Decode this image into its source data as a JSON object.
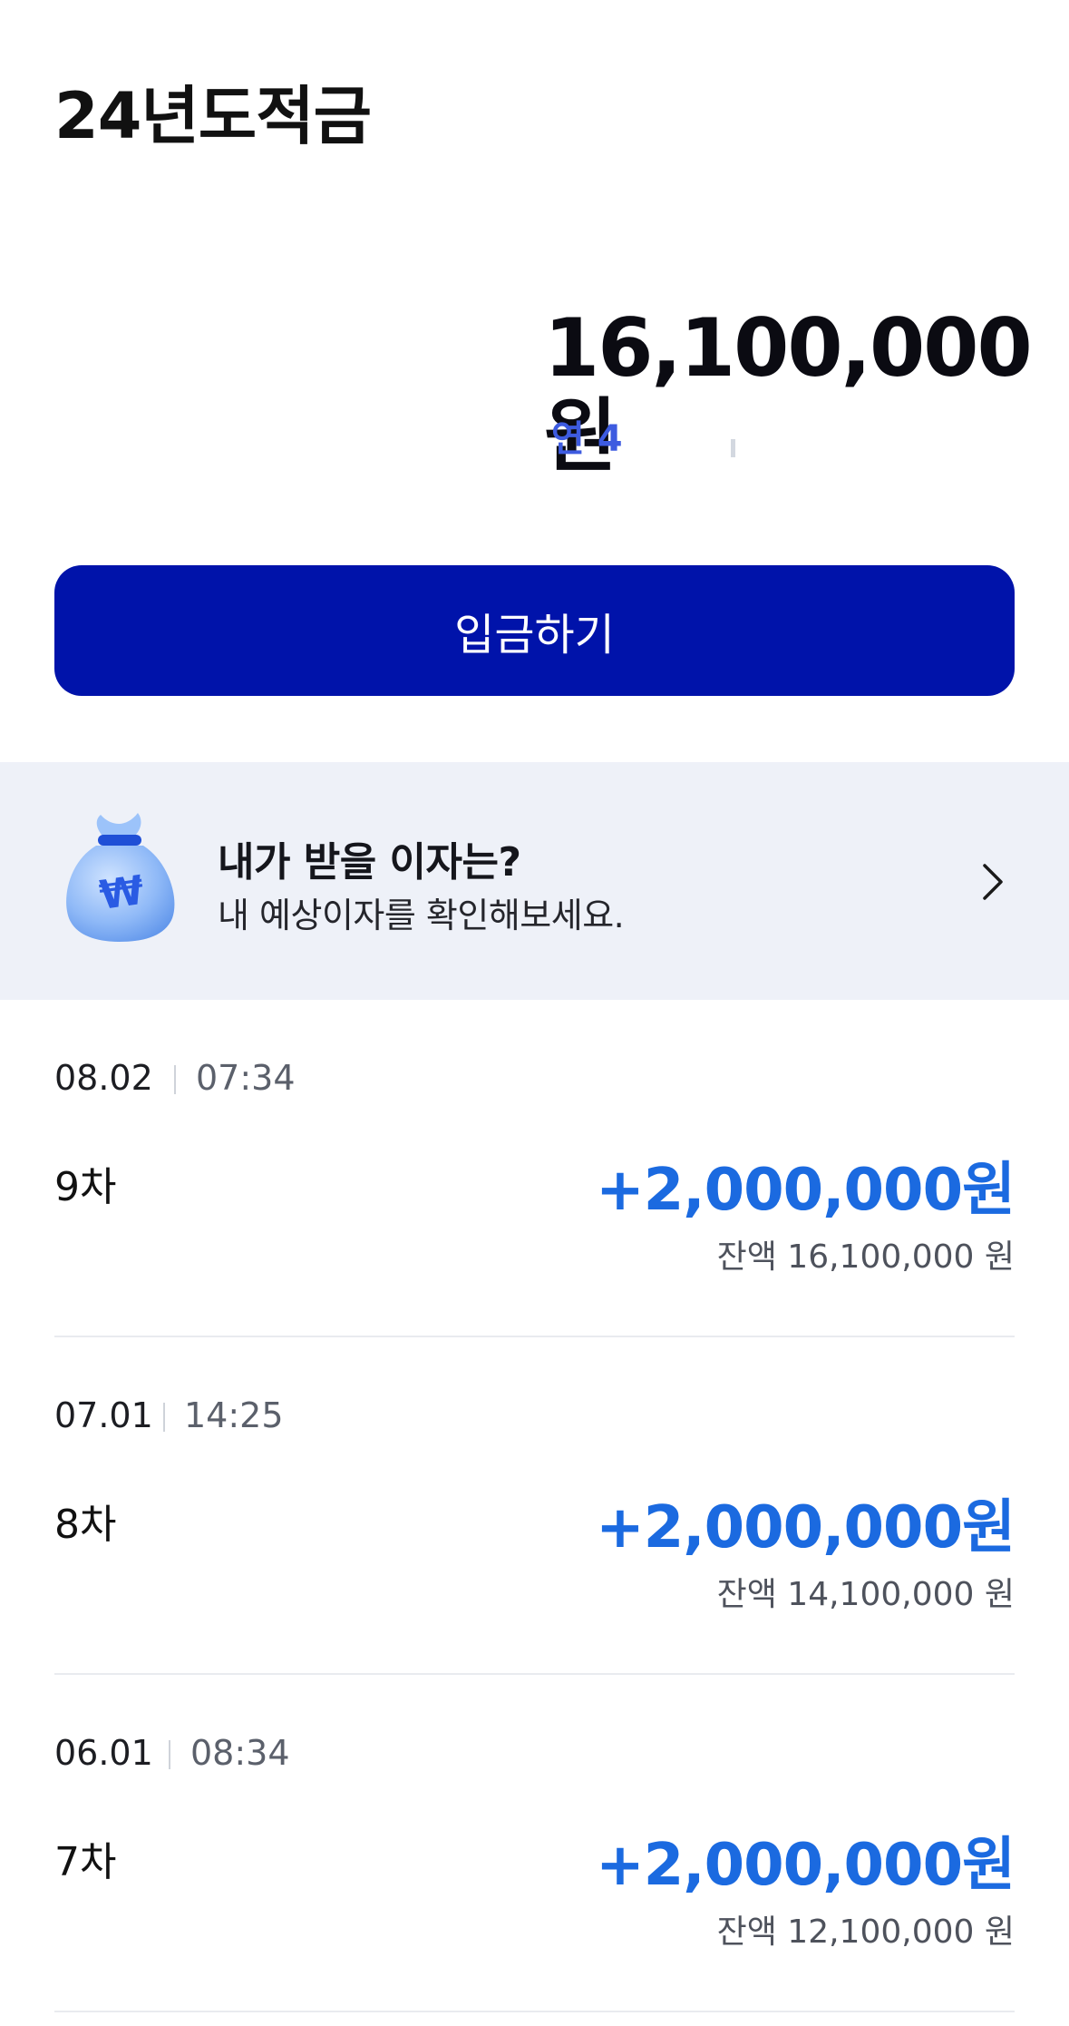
{
  "header": {
    "title": "24년도적금"
  },
  "summary": {
    "balance": "16,100,000원",
    "rate_visible": "연 4"
  },
  "actions": {
    "deposit_label": "입금하기"
  },
  "interest_banner": {
    "title": "내가 받을 이자는?",
    "subtitle": "내 예상이자를 확인해보세요."
  },
  "transactions": [
    {
      "date": "08.02",
      "time": "07:34",
      "round": "9차",
      "amount": "+2,000,000원",
      "balance": "잔액 16,100,000 원"
    },
    {
      "date": "07.01",
      "time": "14:25",
      "round": "8차",
      "amount": "+2,000,000원",
      "balance": "잔액 14,100,000 원"
    },
    {
      "date": "06.01",
      "time": "08:34",
      "round": "7차",
      "amount": "+2,000,000원",
      "balance": "잔액 12,100,000 원"
    }
  ],
  "colors": {
    "primary_button": "#0013aa",
    "amount_blue": "#1b6ae0",
    "rate_blue": "#3d5be0",
    "banner_bg": "#eef1f8"
  },
  "icons": {
    "banner_icon": "money-bag-icon",
    "banner_arrow": "chevron-right-icon"
  }
}
